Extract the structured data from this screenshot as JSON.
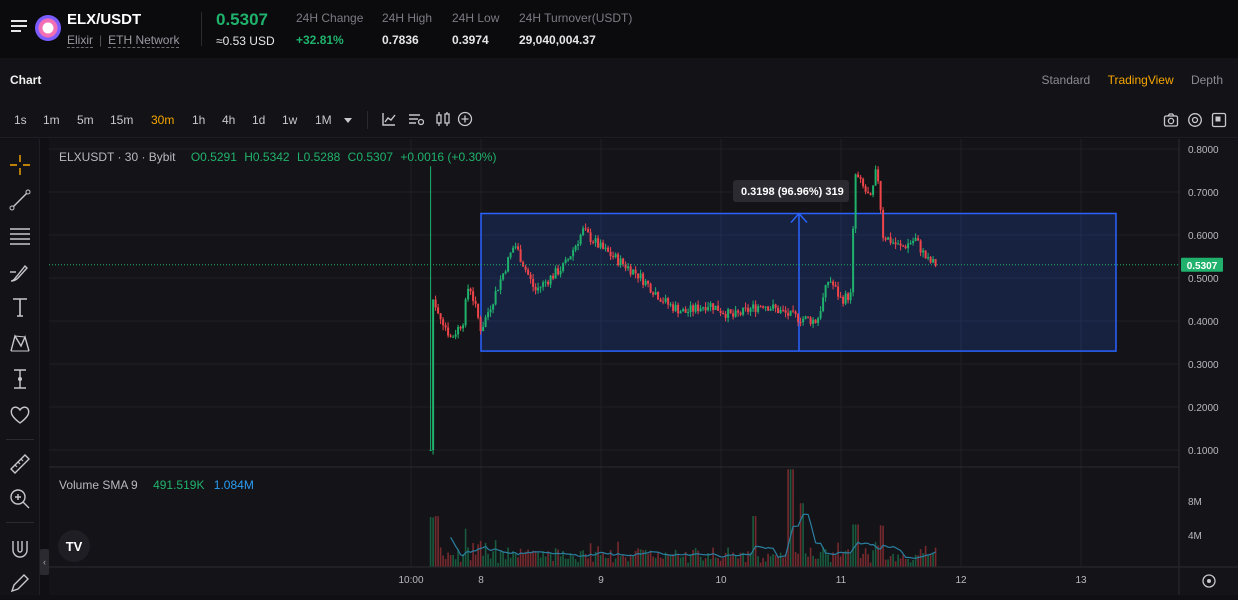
{
  "header": {
    "pair": "ELX/USDT",
    "coin_name": "Elixir",
    "network": "ETH Network",
    "price": "0.5307",
    "price_usd": "≈0.53 USD",
    "stats": [
      {
        "label": "24H Change",
        "value": "+32.81%",
        "green": true
      },
      {
        "label": "24H High",
        "value": "0.7836",
        "green": false
      },
      {
        "label": "24H Low",
        "value": "0.3974",
        "green": false
      },
      {
        "label": "24H Turnover(USDT)",
        "value": "29,040,004.37",
        "green": false
      }
    ]
  },
  "chart_header": {
    "title": "Chart",
    "views": [
      "Standard",
      "TradingView",
      "Depth"
    ],
    "active_view": "TradingView"
  },
  "toolbar": {
    "intervals": [
      "1s",
      "1m",
      "5m",
      "15m",
      "30m",
      "1h",
      "4h",
      "1d",
      "1w",
      "1M"
    ],
    "active_interval": "30m",
    "tools": [
      "indicators-icon",
      "chart-settings-icon",
      "candle-type-icon",
      "add-icon"
    ],
    "right_tools": [
      "camera-icon",
      "settings-icon",
      "fullscreen-icon"
    ]
  },
  "drawing_tools": [
    "crosshair-icon",
    "trend-line-icon",
    "horizontal-lines-icon",
    "brush-icon",
    "text-icon",
    "pattern-icon",
    "measure-icon",
    "favorite-icon",
    "ruler-icon",
    "zoom-icon",
    "magnet-icon",
    "pencil-lock-icon"
  ],
  "legend": {
    "symbol": "ELXUSDT · 30 · Bybit",
    "open": "O0.5291",
    "high": "H0.5342",
    "low": "L0.5288",
    "close": "C0.5307",
    "change": "+0.0016 (+0.30%)"
  },
  "volume_legend": {
    "label": "Volume SMA 9",
    "v1": "491.519K",
    "v2": "1.084M"
  },
  "measure_label": "0.3198 (96.96%) 319",
  "last_price_tag": "0.5307",
  "tv_logo": "TV",
  "chart_data": {
    "type": "candlestick",
    "y_axis_ticks": [
      "0.8000",
      "0.7000",
      "0.6000",
      "0.5000",
      "0.4000",
      "0.3000",
      "0.2000",
      "0.1000"
    ],
    "ylim": [
      0.1,
      0.8
    ],
    "volume_ticks": [
      "8M",
      "4M"
    ],
    "x_axis_ticks": [
      "10:00",
      "8",
      "9",
      "10",
      "11",
      "12",
      "13"
    ],
    "last_price": 0.5307,
    "measure": {
      "from": 0.33,
      "to": 0.65,
      "delta": 0.3198,
      "pct": "96.96%"
    },
    "price_path_keypoints": [
      {
        "t": "10:00",
        "p": 0.1
      },
      {
        "t": "10:00",
        "p": 0.76
      },
      {
        "t": "7.7",
        "p": 0.4
      },
      {
        "t": "7.9",
        "p": 0.49
      },
      {
        "t": "8.0",
        "p": 0.37
      },
      {
        "t": "8.3",
        "p": 0.58
      },
      {
        "t": "8.5",
        "p": 0.47
      },
      {
        "t": "8.85",
        "p": 0.61
      },
      {
        "t": "9.3",
        "p": 0.52
      },
      {
        "t": "9.6",
        "p": 0.43
      },
      {
        "t": "10.2",
        "p": 0.41
      },
      {
        "t": "10.8",
        "p": 0.4
      },
      {
        "t": "11.0",
        "p": 0.48
      },
      {
        "t": "11.1",
        "p": 0.78
      },
      {
        "t": "11.4",
        "p": 0.58
      },
      {
        "t": "11.8",
        "p": 0.5307
      }
    ]
  }
}
